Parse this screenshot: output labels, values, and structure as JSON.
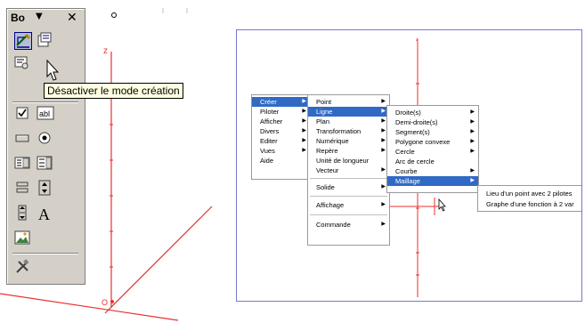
{
  "toolbox": {
    "title": "Bo",
    "dropdown_glyph": "▼",
    "close_glyph": "✕",
    "tooltip": "Désactiver le mode création",
    "buttons": [
      {
        "name": "design-mode-icon"
      },
      {
        "name": "properties-icon"
      },
      {
        "name": "code-icon"
      },
      {
        "name": "checkbox-icon"
      },
      {
        "name": "textbox-icon",
        "label": "abl"
      },
      {
        "name": "command-button-icon"
      },
      {
        "name": "option-button-icon"
      },
      {
        "name": "listbox-icon"
      },
      {
        "name": "combobox-icon"
      },
      {
        "name": "toggle-button-icon"
      },
      {
        "name": "spin-button-icon"
      },
      {
        "name": "scrollbar-icon"
      },
      {
        "name": "label-icon",
        "label": "A"
      },
      {
        "name": "image-icon"
      },
      {
        "name": "more-controls-icon"
      }
    ]
  },
  "left_canvas": {
    "z_label": "z",
    "origin_label": "O"
  },
  "window": {
    "z_label": "z",
    "main_menu": [
      "Créer",
      "Piloter",
      "Afficher",
      "Divers",
      "Editer",
      "Vues",
      "Aide"
    ],
    "creer_menu": {
      "group1": [
        "Point",
        "Ligne",
        "Plan",
        "Transformation",
        "Numérique",
        "Repère",
        "Unité de longueur",
        "Vecteur"
      ],
      "group2": [
        "Solide"
      ],
      "group3": [
        "Affichage"
      ],
      "group4": [
        "Commande"
      ]
    },
    "ligne_menu": [
      "Droite(s)",
      "Demi-droite(s)",
      "Segment(s)",
      "Polygone convexe",
      "Cercle",
      "Arc de cercle",
      "Courbe",
      "Maillage"
    ],
    "maillage_menu": [
      "Lieu d'un point avec 2 pilotes",
      "Graphe d'une fonction à 2 var"
    ]
  },
  "colors": {
    "highlight": "#316ac5",
    "axis": "#e83030",
    "toolbox": "#d4d0c8",
    "tooltip": "#ffffe1"
  }
}
